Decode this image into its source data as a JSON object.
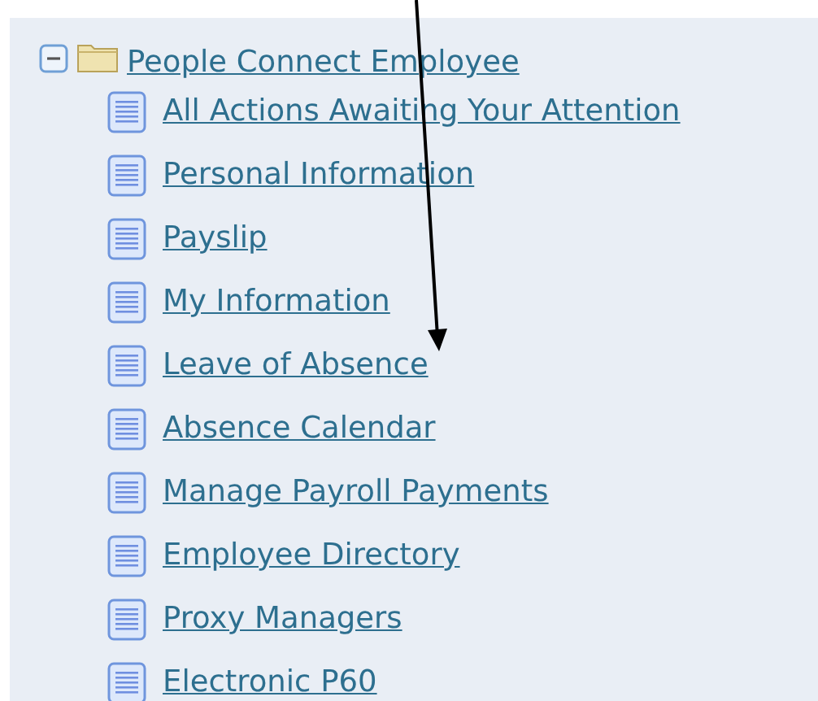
{
  "tree": {
    "label": "People Connect Employee",
    "expanded": true,
    "children": [
      {
        "label": "All Actions Awaiting Your Attention"
      },
      {
        "label": "Personal Information"
      },
      {
        "label": "Payslip"
      },
      {
        "label": "My Information"
      },
      {
        "label": "Leave of Absence"
      },
      {
        "label": "Absence Calendar"
      },
      {
        "label": "Manage Payroll Payments"
      },
      {
        "label": "Employee Directory"
      },
      {
        "label": "Proxy Managers"
      },
      {
        "label": "Electronic P60"
      }
    ]
  }
}
